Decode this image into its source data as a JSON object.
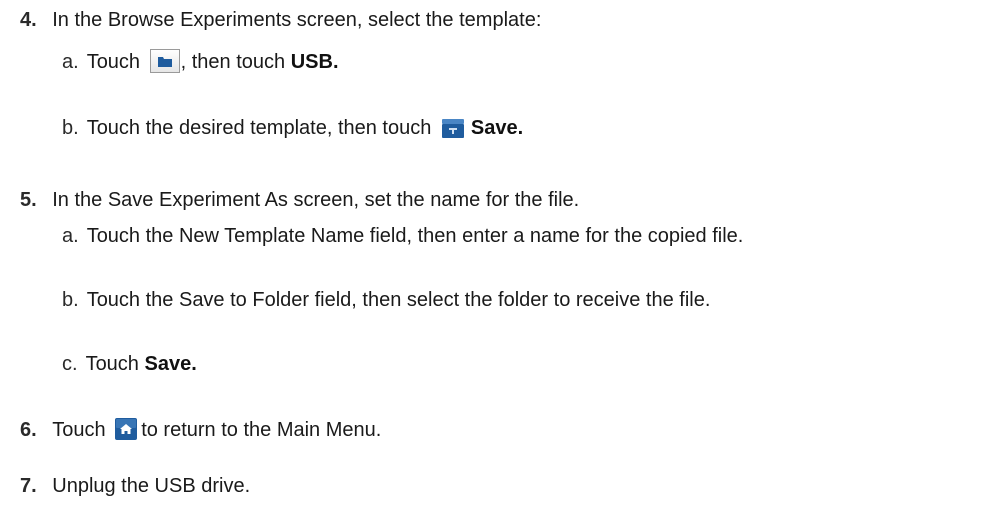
{
  "steps": [
    {
      "number": "4.",
      "text": "In the Browse Experiments screen, select the template:",
      "substeps": [
        {
          "letter": "a.",
          "pre": "Touch",
          "post": ", then touch",
          "bold": "USB."
        },
        {
          "letter": "b.",
          "pre": "Touch the desired template, then touch",
          "bold": "Save."
        }
      ]
    },
    {
      "number": "5.",
      "text": "In the Save Experiment As screen, set the name for the file.",
      "substeps": [
        {
          "letter": "a.",
          "text": "Touch the New Template Name field, then enter a name for the copied file."
        },
        {
          "letter": "b.",
          "text": "Touch the Save to Folder field, then select the folder to receive the file."
        },
        {
          "letter": "c.",
          "pre": "Touch",
          "bold": "Save."
        }
      ]
    },
    {
      "number": "6.",
      "pre": "Touch",
      "post": "to return to the Main Menu."
    },
    {
      "number": "7.",
      "text": "Unplug the USB drive."
    }
  ],
  "icons": {
    "folder": "folder-icon",
    "save": "save-icon",
    "home": "home-icon"
  },
  "colors": {
    "icon_blue": "#1f5c9e",
    "icon_blue_light": "#4a86c5"
  }
}
